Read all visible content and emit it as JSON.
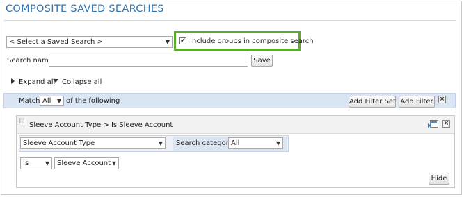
{
  "page": {
    "title": "COMPOSITE SAVED SEARCHES"
  },
  "saved_search": {
    "selected": "< Select a Saved Search >",
    "include_groups_label": "Include groups in composite search",
    "include_groups_checked": true
  },
  "search_name": {
    "label": "Search name:",
    "value": "",
    "save_label": "Save"
  },
  "tree_controls": {
    "expand_all": "Expand all",
    "collapse_all": "Collapse all"
  },
  "match_bar": {
    "match_label": "Match",
    "match_value": "All",
    "following_label": "of the following",
    "add_filter_set_label": "Add Filter Set",
    "add_filter_label": "Add Filter",
    "close_symbol": "×"
  },
  "filter": {
    "header": "Sleeve Account Type  >  Is Sleeve Account",
    "field_value": "Sleeve Account Type",
    "search_category_label": "Search category:",
    "search_category_value": "All",
    "operator_value": "Is",
    "value_value": "Sleeve Account",
    "hide_label": "Hide",
    "close_symbol": "×"
  },
  "colors": {
    "title": "#2e76b5",
    "highlight_border": "#5aac2e",
    "match_bar_bg": "#d9e5f3"
  }
}
